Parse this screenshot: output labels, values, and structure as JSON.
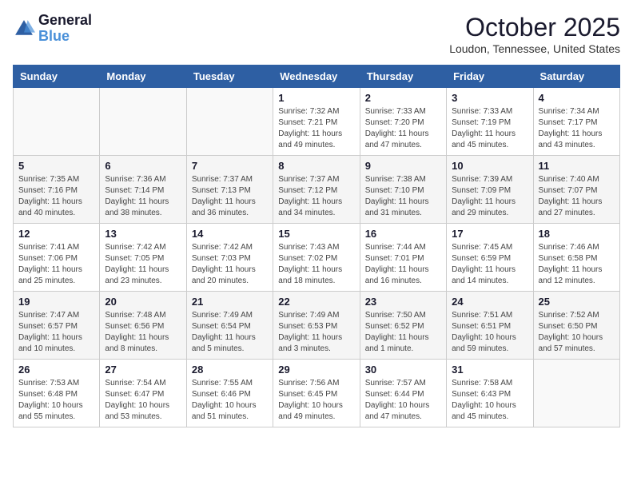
{
  "header": {
    "logo_line1": "General",
    "logo_line2": "Blue",
    "month": "October 2025",
    "location": "Loudon, Tennessee, United States"
  },
  "days_of_week": [
    "Sunday",
    "Monday",
    "Tuesday",
    "Wednesday",
    "Thursday",
    "Friday",
    "Saturday"
  ],
  "weeks": [
    [
      {
        "day": "",
        "info": ""
      },
      {
        "day": "",
        "info": ""
      },
      {
        "day": "",
        "info": ""
      },
      {
        "day": "1",
        "info": "Sunrise: 7:32 AM\nSunset: 7:21 PM\nDaylight: 11 hours and 49 minutes."
      },
      {
        "day": "2",
        "info": "Sunrise: 7:33 AM\nSunset: 7:20 PM\nDaylight: 11 hours and 47 minutes."
      },
      {
        "day": "3",
        "info": "Sunrise: 7:33 AM\nSunset: 7:19 PM\nDaylight: 11 hours and 45 minutes."
      },
      {
        "day": "4",
        "info": "Sunrise: 7:34 AM\nSunset: 7:17 PM\nDaylight: 11 hours and 43 minutes."
      }
    ],
    [
      {
        "day": "5",
        "info": "Sunrise: 7:35 AM\nSunset: 7:16 PM\nDaylight: 11 hours and 40 minutes."
      },
      {
        "day": "6",
        "info": "Sunrise: 7:36 AM\nSunset: 7:14 PM\nDaylight: 11 hours and 38 minutes."
      },
      {
        "day": "7",
        "info": "Sunrise: 7:37 AM\nSunset: 7:13 PM\nDaylight: 11 hours and 36 minutes."
      },
      {
        "day": "8",
        "info": "Sunrise: 7:37 AM\nSunset: 7:12 PM\nDaylight: 11 hours and 34 minutes."
      },
      {
        "day": "9",
        "info": "Sunrise: 7:38 AM\nSunset: 7:10 PM\nDaylight: 11 hours and 31 minutes."
      },
      {
        "day": "10",
        "info": "Sunrise: 7:39 AM\nSunset: 7:09 PM\nDaylight: 11 hours and 29 minutes."
      },
      {
        "day": "11",
        "info": "Sunrise: 7:40 AM\nSunset: 7:07 PM\nDaylight: 11 hours and 27 minutes."
      }
    ],
    [
      {
        "day": "12",
        "info": "Sunrise: 7:41 AM\nSunset: 7:06 PM\nDaylight: 11 hours and 25 minutes."
      },
      {
        "day": "13",
        "info": "Sunrise: 7:42 AM\nSunset: 7:05 PM\nDaylight: 11 hours and 23 minutes."
      },
      {
        "day": "14",
        "info": "Sunrise: 7:42 AM\nSunset: 7:03 PM\nDaylight: 11 hours and 20 minutes."
      },
      {
        "day": "15",
        "info": "Sunrise: 7:43 AM\nSunset: 7:02 PM\nDaylight: 11 hours and 18 minutes."
      },
      {
        "day": "16",
        "info": "Sunrise: 7:44 AM\nSunset: 7:01 PM\nDaylight: 11 hours and 16 minutes."
      },
      {
        "day": "17",
        "info": "Sunrise: 7:45 AM\nSunset: 6:59 PM\nDaylight: 11 hours and 14 minutes."
      },
      {
        "day": "18",
        "info": "Sunrise: 7:46 AM\nSunset: 6:58 PM\nDaylight: 11 hours and 12 minutes."
      }
    ],
    [
      {
        "day": "19",
        "info": "Sunrise: 7:47 AM\nSunset: 6:57 PM\nDaylight: 11 hours and 10 minutes."
      },
      {
        "day": "20",
        "info": "Sunrise: 7:48 AM\nSunset: 6:56 PM\nDaylight: 11 hours and 8 minutes."
      },
      {
        "day": "21",
        "info": "Sunrise: 7:49 AM\nSunset: 6:54 PM\nDaylight: 11 hours and 5 minutes."
      },
      {
        "day": "22",
        "info": "Sunrise: 7:49 AM\nSunset: 6:53 PM\nDaylight: 11 hours and 3 minutes."
      },
      {
        "day": "23",
        "info": "Sunrise: 7:50 AM\nSunset: 6:52 PM\nDaylight: 11 hours and 1 minute."
      },
      {
        "day": "24",
        "info": "Sunrise: 7:51 AM\nSunset: 6:51 PM\nDaylight: 10 hours and 59 minutes."
      },
      {
        "day": "25",
        "info": "Sunrise: 7:52 AM\nSunset: 6:50 PM\nDaylight: 10 hours and 57 minutes."
      }
    ],
    [
      {
        "day": "26",
        "info": "Sunrise: 7:53 AM\nSunset: 6:48 PM\nDaylight: 10 hours and 55 minutes."
      },
      {
        "day": "27",
        "info": "Sunrise: 7:54 AM\nSunset: 6:47 PM\nDaylight: 10 hours and 53 minutes."
      },
      {
        "day": "28",
        "info": "Sunrise: 7:55 AM\nSunset: 6:46 PM\nDaylight: 10 hours and 51 minutes."
      },
      {
        "day": "29",
        "info": "Sunrise: 7:56 AM\nSunset: 6:45 PM\nDaylight: 10 hours and 49 minutes."
      },
      {
        "day": "30",
        "info": "Sunrise: 7:57 AM\nSunset: 6:44 PM\nDaylight: 10 hours and 47 minutes."
      },
      {
        "day": "31",
        "info": "Sunrise: 7:58 AM\nSunset: 6:43 PM\nDaylight: 10 hours and 45 minutes."
      },
      {
        "day": "",
        "info": ""
      }
    ]
  ]
}
